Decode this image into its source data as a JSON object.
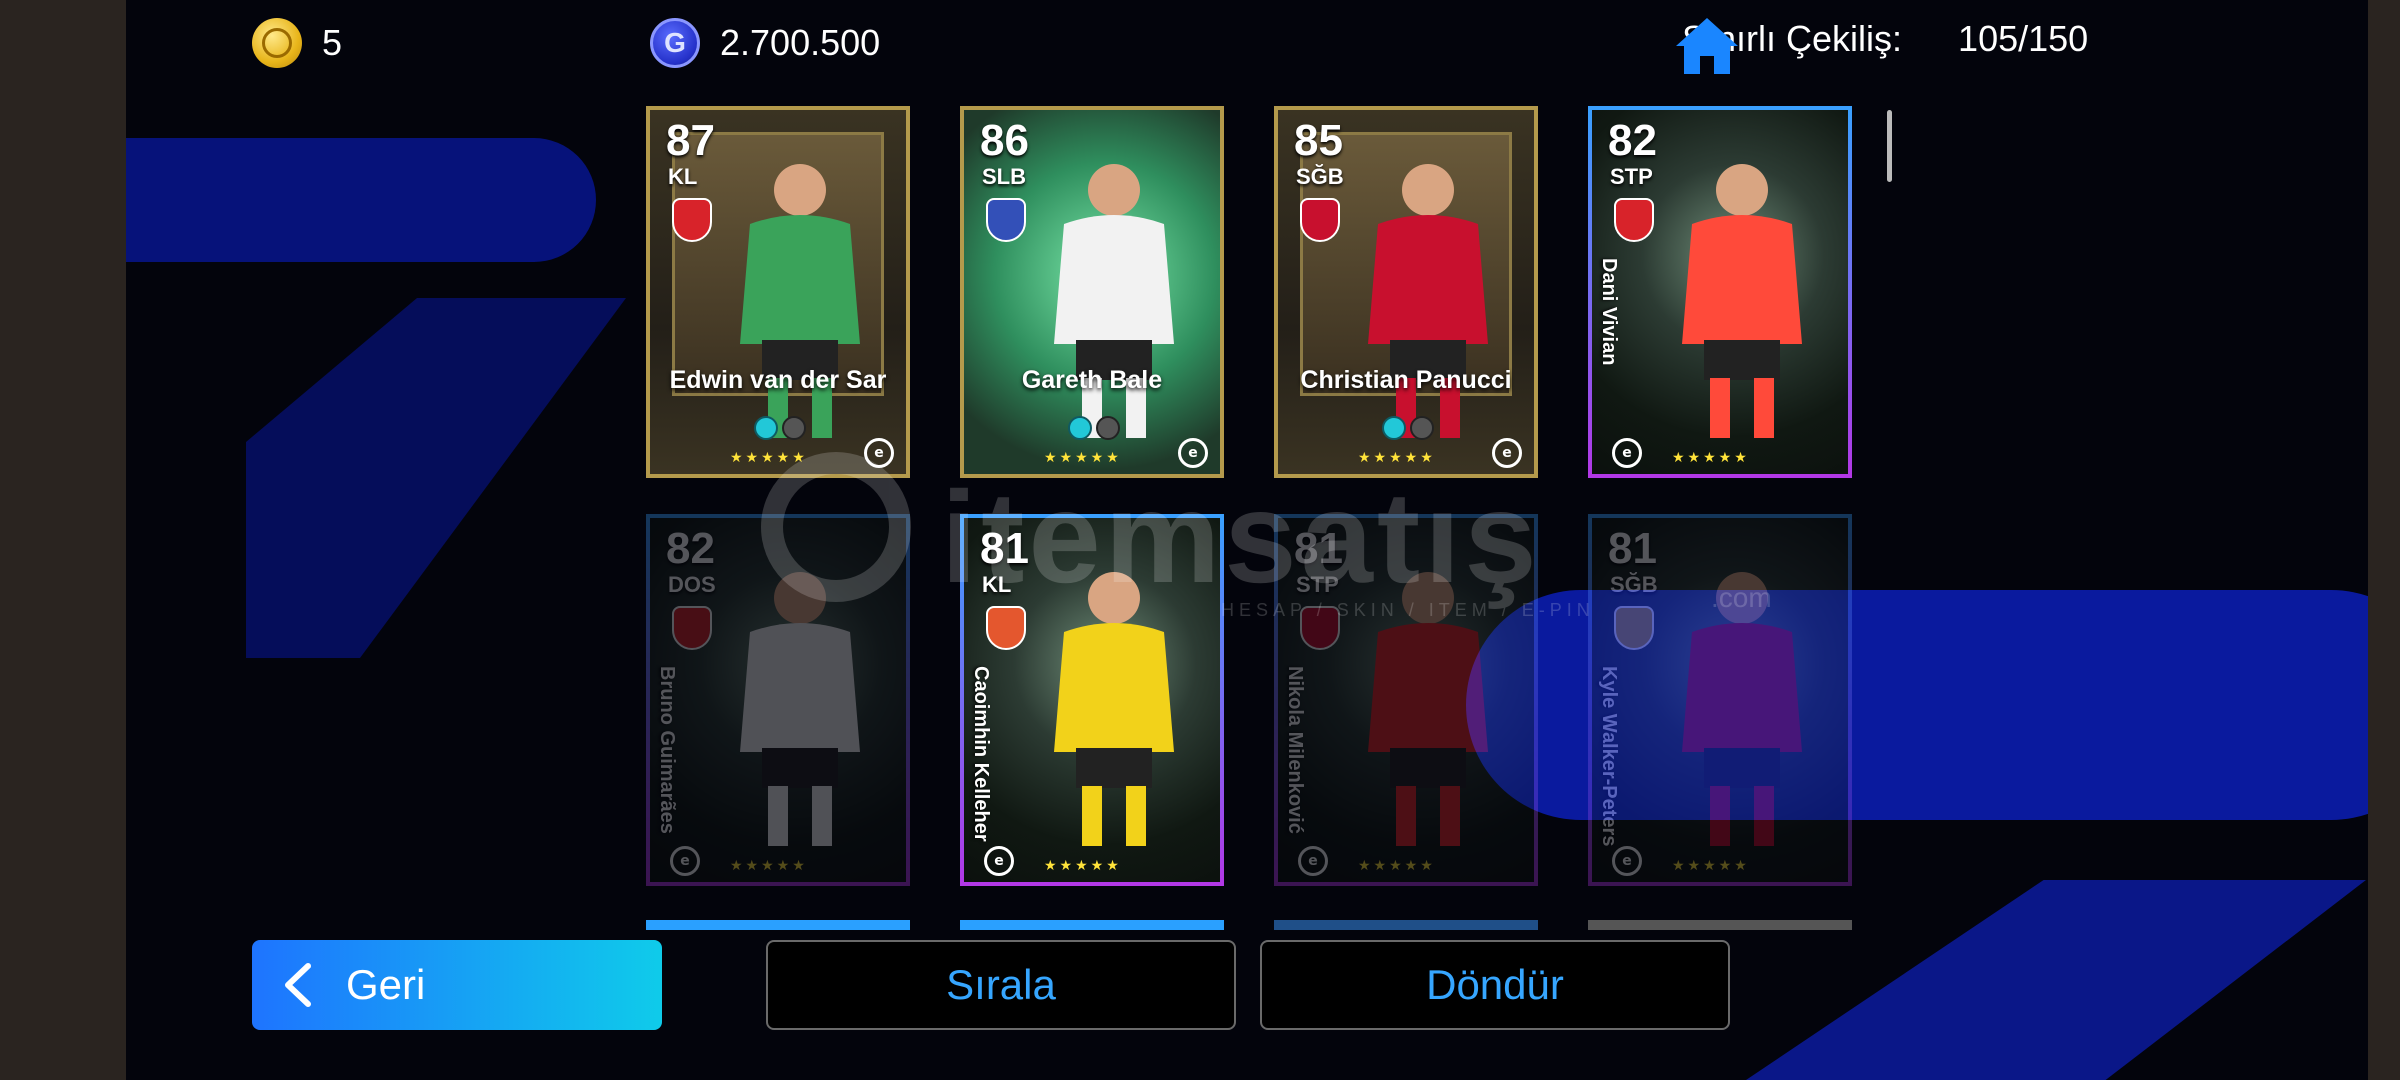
{
  "topbar": {
    "coins": "5",
    "gp": "2.700.500",
    "gp_icon_letter": "G",
    "draw_label": "Sınırlı Çekiliş:",
    "draw_count": "105/150"
  },
  "cards": [
    {
      "rating": "87",
      "position": "KL",
      "name": "Edwin van der Sar",
      "style": "gold",
      "name_orientation": "horizontal",
      "stars": "★★★★★"
    },
    {
      "rating": "86",
      "position": "SLB",
      "name": "Gareth Bale",
      "style": "legend",
      "name_orientation": "horizontal",
      "stars": "★★★★★"
    },
    {
      "rating": "85",
      "position": "SĞB",
      "name": "Christian Panucci",
      "style": "gold",
      "name_orientation": "horizontal",
      "stars": "★★★★★"
    },
    {
      "rating": "82",
      "position": "STP",
      "name": "Dani Vivian",
      "style": "standard",
      "name_orientation": "vertical",
      "stars": "★★★★★"
    },
    {
      "rating": "82",
      "position": "DOS",
      "name": "Bruno Guimarães",
      "style": "standard",
      "dimmed": true,
      "name_orientation": "vertical",
      "stars": "★★★★★"
    },
    {
      "rating": "81",
      "position": "KL",
      "name": "Caoimhin Kelleher",
      "style": "standard",
      "name_orientation": "vertical",
      "stars": "★★★★★"
    },
    {
      "rating": "81",
      "position": "STP",
      "name": "Nikola Milenković",
      "style": "standard",
      "dimmed": true,
      "name_orientation": "vertical",
      "stars": "★★★★★"
    },
    {
      "rating": "81",
      "position": "SĞB",
      "name": "Kyle Walker-Peters",
      "style": "standard",
      "dimmed": true,
      "name_orientation": "vertical",
      "stars": "★★★★★"
    }
  ],
  "watermark": {
    "brand": "itemsatış",
    "tagline": "HESAP / SKIN / ITEM / E-PIN",
    "domain": ".com"
  },
  "buttons": {
    "back": "Geri",
    "sort": "Sırala",
    "rotate": "Döndür"
  },
  "colors": {
    "accent_blue": "#36a6ff",
    "gold_border": "#b49a4c",
    "star": "#ffe33a"
  }
}
